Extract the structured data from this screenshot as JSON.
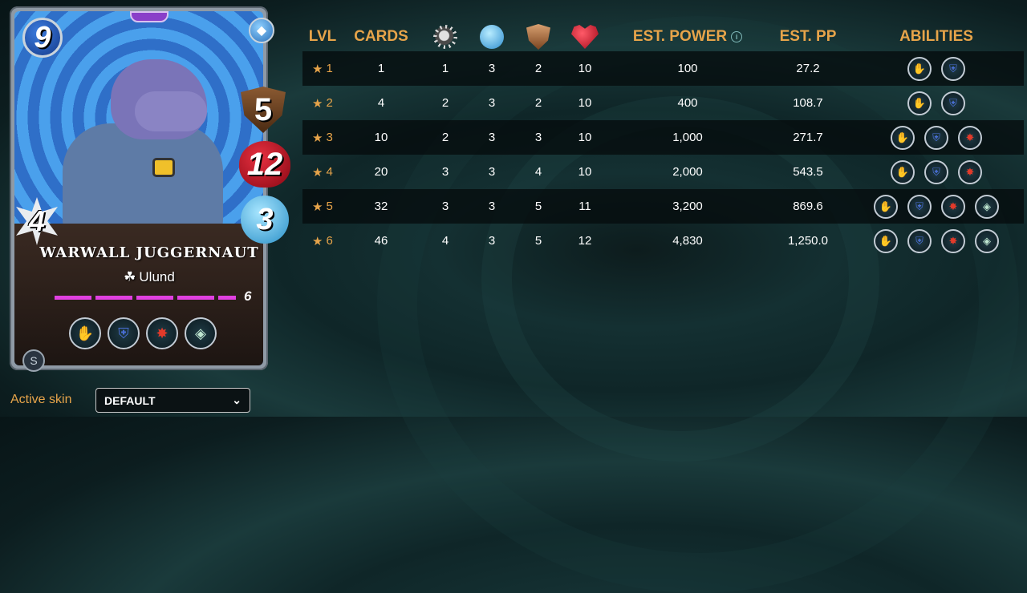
{
  "card": {
    "name": "WARWALL JUGGERNAUT",
    "edition": "Ulund",
    "mana": "9",
    "stats": {
      "armor": "5",
      "health": "12",
      "speed": "3",
      "melee": "4"
    },
    "level": "6",
    "xp_progress": 1.0,
    "abilities": [
      "claw-icon",
      "shield-icon",
      "enrage-icon",
      "diamond-icon"
    ]
  },
  "skin": {
    "label": "Active skin",
    "value": "DEFAULT"
  },
  "table": {
    "headers": {
      "lvl": "LVL",
      "cards": "CARDS",
      "attack_icon": "melee-attack-icon",
      "speed_icon": "speed-icon",
      "armor_icon": "armor-icon",
      "health_icon": "health-icon",
      "est_power": "EST. POWER",
      "est_pp": "EST. PP",
      "abilities": "ABILITIES"
    },
    "star": "★",
    "rows": [
      {
        "lvl": "1",
        "cards": "1",
        "attack": "1",
        "speed": "3",
        "armor": "2",
        "health": "10",
        "power": "100",
        "pp": "27.2",
        "abilities": [
          "claw-icon",
          "shield-icon"
        ]
      },
      {
        "lvl": "2",
        "cards": "4",
        "attack": "2",
        "speed": "3",
        "armor": "2",
        "health": "10",
        "power": "400",
        "pp": "108.7",
        "abilities": [
          "claw-icon",
          "shield-icon"
        ]
      },
      {
        "lvl": "3",
        "cards": "10",
        "attack": "2",
        "speed": "3",
        "armor": "3",
        "health": "10",
        "power": "1,000",
        "pp": "271.7",
        "abilities": [
          "claw-icon",
          "shield-icon",
          "enrage-icon"
        ]
      },
      {
        "lvl": "4",
        "cards": "20",
        "attack": "3",
        "speed": "3",
        "armor": "4",
        "health": "10",
        "power": "2,000",
        "pp": "543.5",
        "abilities": [
          "claw-icon",
          "shield-icon",
          "enrage-icon"
        ]
      },
      {
        "lvl": "5",
        "cards": "32",
        "attack": "3",
        "speed": "3",
        "armor": "5",
        "health": "11",
        "power": "3,200",
        "pp": "869.6",
        "abilities": [
          "claw-icon",
          "shield-icon",
          "enrage-icon",
          "diamond-icon"
        ]
      },
      {
        "lvl": "6",
        "cards": "46",
        "attack": "4",
        "speed": "3",
        "armor": "5",
        "health": "12",
        "power": "4,830",
        "pp": "1,250.0",
        "abilities": [
          "claw-icon",
          "shield-icon",
          "enrage-icon",
          "diamond-icon"
        ]
      }
    ]
  },
  "colors": {
    "accent": "#e7a44a",
    "row_dark": "#050c0d",
    "text": "#ffffff"
  }
}
